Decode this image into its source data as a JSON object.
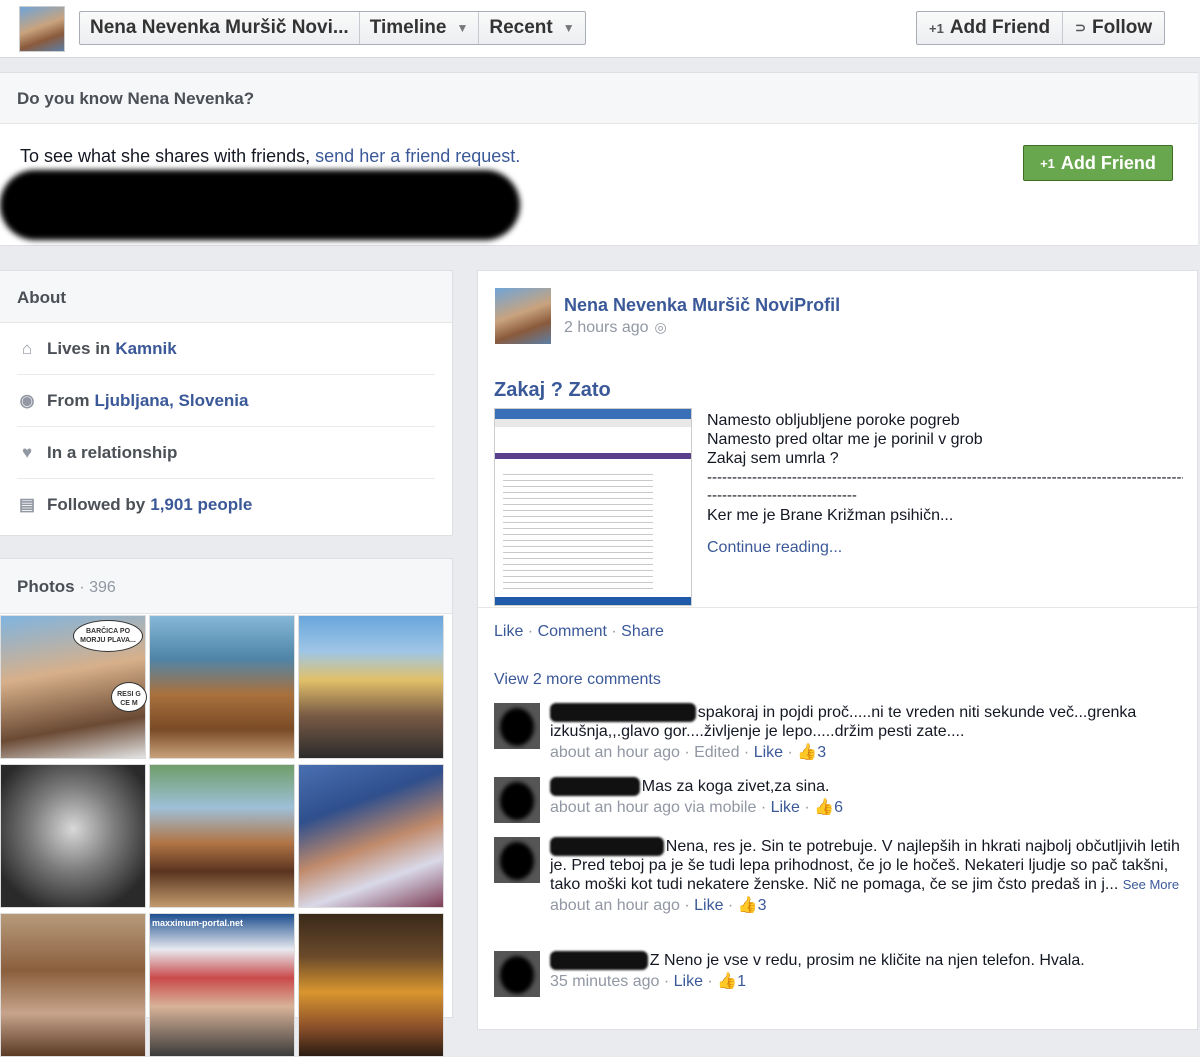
{
  "header": {
    "profile_name": "Nena Nevenka Muršič Novi...",
    "timeline_label": "Timeline",
    "recent_label": "Recent",
    "add_friend_label": "Add Friend",
    "follow_label": "Follow"
  },
  "know": {
    "title": "Do you know Nena Nevenka?",
    "text_prefix": "To see what she shares with friends, ",
    "text_link": "send her a friend request.",
    "add_friend_label": "Add Friend"
  },
  "about": {
    "title": "About",
    "items": [
      {
        "icon": "home-icon",
        "prefix": "Lives in",
        "value": "Kamnik"
      },
      {
        "icon": "location-pin-icon",
        "prefix": "From",
        "value": "Ljubljana, Slovenia"
      },
      {
        "icon": "heart-icon",
        "prefix": "In a relationship",
        "value": ""
      },
      {
        "icon": "rss-icon",
        "prefix": "Followed by",
        "value": "1,901 people"
      }
    ]
  },
  "photos": {
    "title": "Photos",
    "count": "· 396",
    "bubble_text_1": "BARČICA PO MORJU PLAVA...",
    "bubble_text_2": "RESI G CE M",
    "banner_text": "maxximum-portal.net"
  },
  "post": {
    "author": "Nena Nevenka Muršič NoviProfil",
    "time": "2 hours ago",
    "title": "Zakaj ? Zato",
    "lines": [
      "Namesto obljubljene poroke pogreb",
      "Namesto pred oltar me  je porinil v grob",
      "Zakaj sem umrla ?"
    ],
    "dashes_long": "------------------------------------------------------------------------------------------------------------",
    "dashes_short": "------------------------------",
    "last_line": "Ker me je Brane Križman psihičn...",
    "continue": "Continue reading...",
    "actions": {
      "like": "Like",
      "comment": "Comment",
      "share": "Share"
    },
    "view_more": "View 2 more comments"
  },
  "comments": [
    {
      "text": "spakoraj in pojdi proč.....ni te vreden niti sekunde več...grenka izkušnja,,.glavo gor....življenje je lepo.....držim pesti zate....",
      "time": "about an hour ago",
      "edited": "Edited",
      "like": "Like",
      "likes": "3"
    },
    {
      "text": "Mas za koga zivet,za sina.",
      "time": "about an hour ago via mobile",
      "like": "Like",
      "likes": "6"
    },
    {
      "text": "Nena, res je. Sin te potrebuje. V najlepših in hkrati najbolj občutljivih letih je. Pred teboj pa je še tudi lepa prihodnost, če jo le hočeš. Nekateri ljudje so pač takšni, tako moški kot tudi nekatere ženske. Nič ne pomaga, če se jim čsto predaš in j...",
      "see_more": "See More",
      "time": "about an hour ago",
      "like": "Like",
      "likes": "3"
    },
    {
      "text": "Z Neno je vse v redu, prosim ne kličite na njen telefon. Hvala.",
      "time": "35 minutes ago",
      "like": "Like",
      "likes": "1"
    }
  ]
}
